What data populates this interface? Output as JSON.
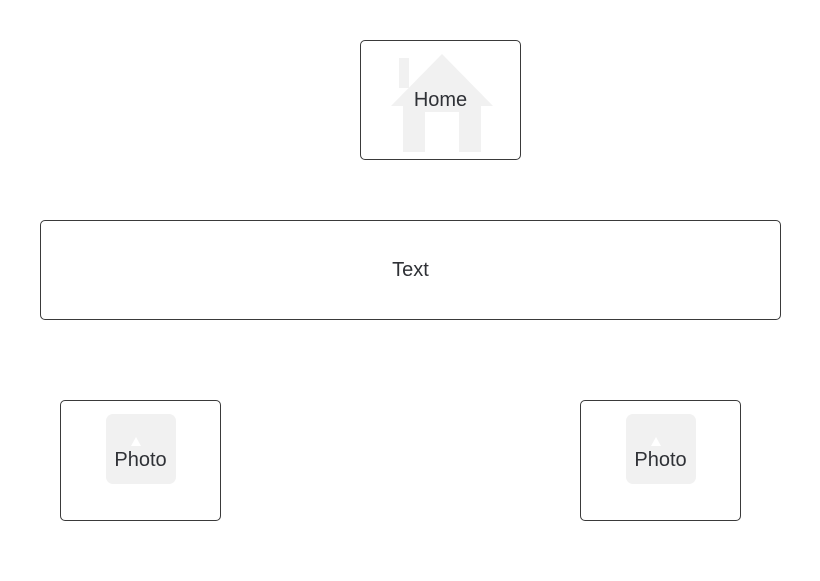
{
  "canvas": {
    "background": "#ffffff",
    "border_color": "#3a3a3a",
    "placeholder_color": "#f1f1f1"
  },
  "nodes": {
    "home": {
      "label": "Home",
      "icon": "house-icon"
    },
    "text": {
      "label": "Text"
    },
    "photo_left": {
      "label": "Photo",
      "icon": "image-placeholder-icon"
    },
    "photo_right": {
      "label": "Photo",
      "icon": "image-placeholder-icon"
    }
  }
}
